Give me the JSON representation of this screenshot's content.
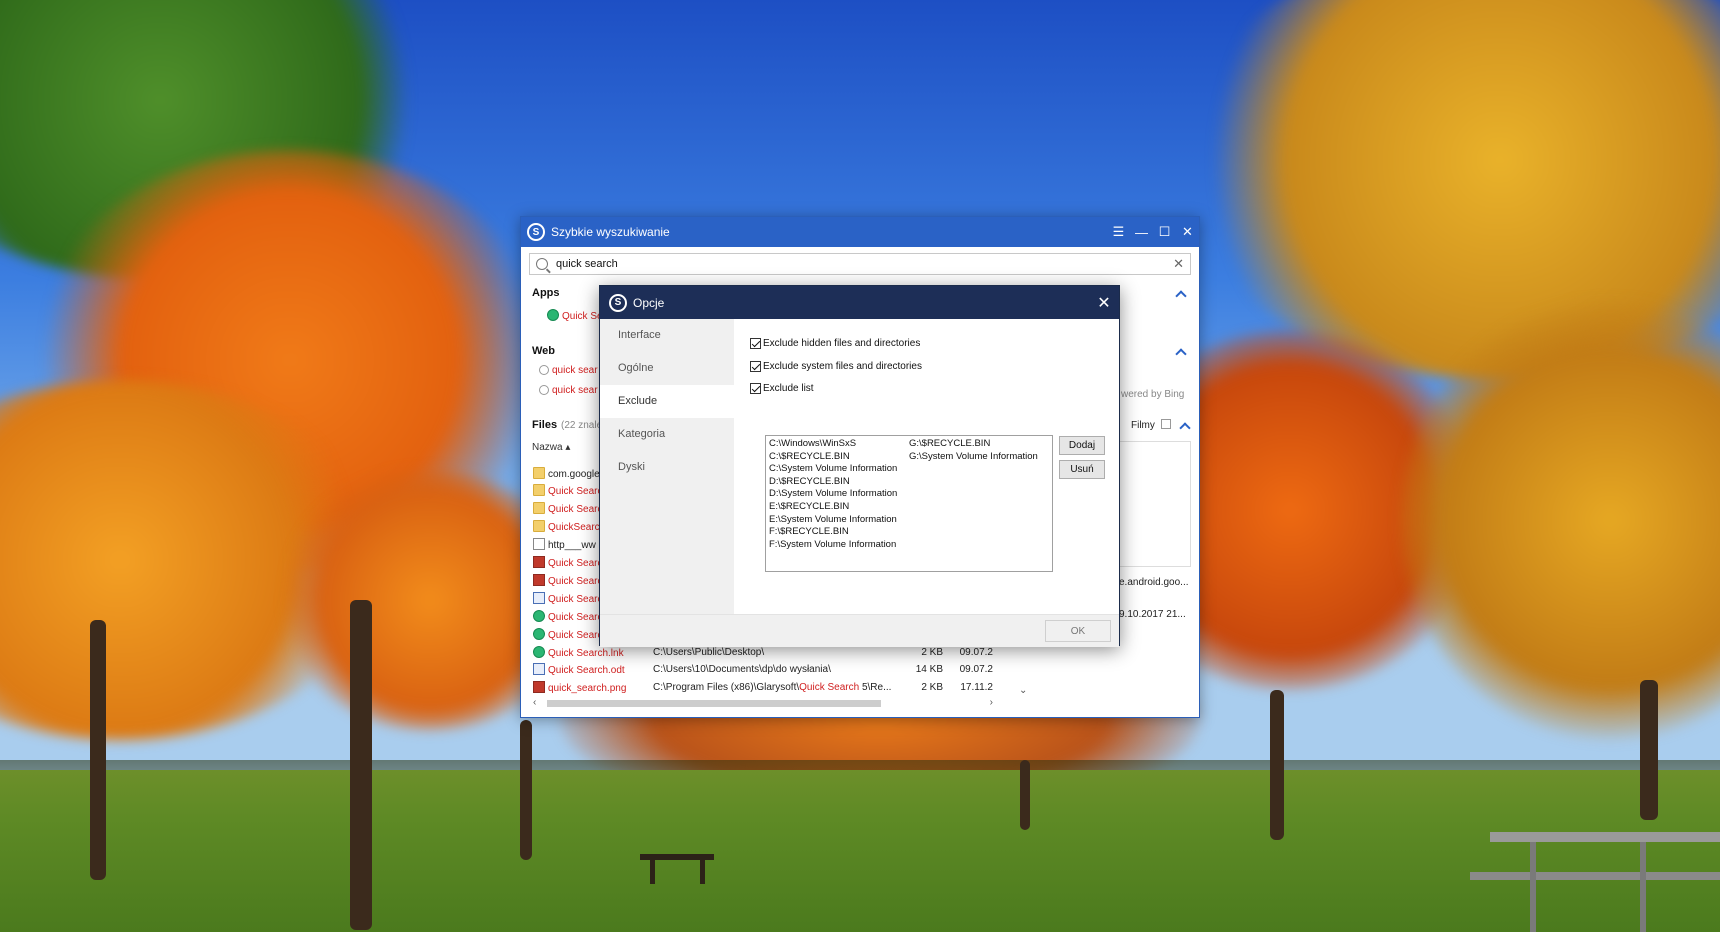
{
  "main_window": {
    "title": "Szybkie wyszukiwanie",
    "search": {
      "value": "quick search"
    },
    "apps": {
      "heading": "Apps",
      "items": [
        {
          "label": "Quick Sea",
          "icon": "app-icon"
        }
      ]
    },
    "web": {
      "heading": "Web",
      "items": [
        {
          "label": "quick sear"
        },
        {
          "label": "quick sear"
        }
      ],
      "powered_by": "wered by Bing"
    },
    "files": {
      "heading": "Files",
      "count": "(22 znale",
      "column_name": "Nazwa",
      "filter": "Filmy",
      "preview_name": "e.android.goo...",
      "preview_date": "9.10.2017 21..."
    },
    "rows": [
      {
        "name": "com.google",
        "icon": "folder-icon",
        "red": false,
        "path": "",
        "size": "",
        "date": ""
      },
      {
        "name": "Quick Searc",
        "icon": "folder-icon",
        "red": true,
        "path": "",
        "size": "",
        "date": ""
      },
      {
        "name": "Quick Searc",
        "icon": "folder-icon",
        "red": true,
        "path": "",
        "size": "",
        "date": ""
      },
      {
        "name": "QuickSearch",
        "icon": "folder-icon",
        "red": true,
        "path": "",
        "size": "",
        "date": ""
      },
      {
        "name": "http___ww",
        "icon": "file-icon",
        "red": false,
        "path": "",
        "size": "",
        "date": ""
      },
      {
        "name": "Quick Searc",
        "icon": "image-icon",
        "red": true,
        "path": "",
        "size": "",
        "date": ""
      },
      {
        "name": "Quick Searc",
        "icon": "image-icon",
        "red": true,
        "path": "",
        "size": "",
        "date": ""
      },
      {
        "name": "Quick Searc",
        "icon": "document-icon",
        "red": true,
        "path": "",
        "size": "",
        "date": ""
      },
      {
        "name": "Quick Searc",
        "icon": "app-icon",
        "red": true,
        "path": "",
        "size": "",
        "date": ""
      },
      {
        "name": "Quick Searc",
        "icon": "app-icon",
        "red": true,
        "path": "",
        "size": "",
        "date": ""
      },
      {
        "name": "Quick Search.lnk",
        "icon": "app-icon",
        "red": true,
        "path": "C:\\Users\\Public\\Desktop\\",
        "size": "2 KB",
        "date": "09.07.2"
      },
      {
        "name": "Quick Search.odt",
        "icon": "document-icon",
        "red": true,
        "path": "C:\\Users\\10\\Documents\\dp\\do wysłania\\",
        "size": "14 KB",
        "date": "09.07.2"
      },
      {
        "name": "quick_search.png",
        "icon": "image-icon",
        "red": true,
        "path_prefix": "C:\\Program Files (x86)\\Glarysoft\\",
        "path_highlight": "Quick Search",
        "path_suffix": " 5\\Re...",
        "size": "2 KB",
        "date": "17.11.2"
      }
    ]
  },
  "options_dialog": {
    "title": "Opcje",
    "nav": [
      "Interface",
      "Ogólne",
      "Exclude",
      "Kategoria",
      "Dyski"
    ],
    "active_nav": "Exclude",
    "checks": [
      {
        "label": "Exclude hidden files and directories",
        "checked": true
      },
      {
        "label": "Exclude system files and directories",
        "checked": true
      },
      {
        "label": "Exclude list",
        "checked": true
      }
    ],
    "exclude_list_col1": [
      "C:\\Windows\\WinSxS",
      "C:\\$RECYCLE.BIN",
      "C:\\System Volume Information",
      "D:\\$RECYCLE.BIN",
      "D:\\System Volume Information",
      "E:\\$RECYCLE.BIN",
      "E:\\System Volume Information",
      "F:\\$RECYCLE.BIN",
      "F:\\System Volume Information"
    ],
    "exclude_list_col2": [
      "G:\\$RECYCLE.BIN",
      "G:\\System Volume Information"
    ],
    "add_label": "Dodaj",
    "remove_label": "Usuń",
    "ok_label": "OK"
  },
  "colors": {
    "main_titlebar": "#2a62c6",
    "dialog_titlebar": "#1d2e57",
    "highlight_red": "#d02020"
  }
}
